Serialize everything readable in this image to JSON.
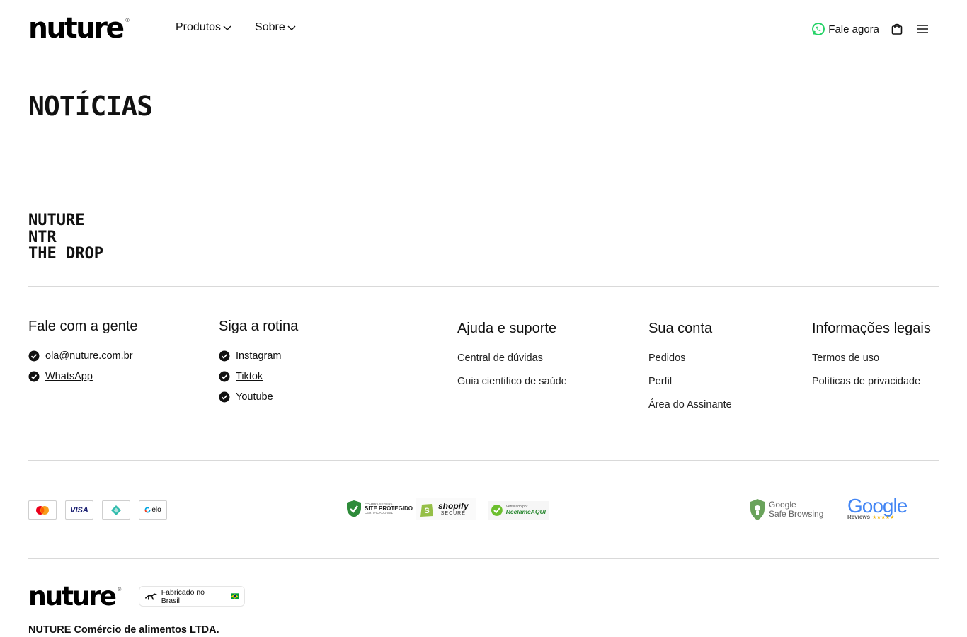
{
  "header": {
    "logo": "nuture",
    "logo_mark": "®",
    "nav": [
      {
        "label": "Produtos"
      },
      {
        "label": "Sobre"
      }
    ],
    "contact_label": "Fale agora",
    "icons": {
      "whatsapp": "whatsapp-icon",
      "cart": "shopping-bag-icon",
      "menu": "hamburger-menu-icon",
      "chevron": "chevron-down-icon"
    },
    "accent_color": "#25d366"
  },
  "page": {
    "title": "NOTÍCIAS"
  },
  "brands": [
    "NUTURE",
    "NTR",
    "THE DROP"
  ],
  "footer": {
    "contact": {
      "title": "Fale com a gente",
      "links": [
        "ola@nuture.com.br",
        "WhatsApp"
      ]
    },
    "social": {
      "title": "Siga a rotina",
      "links": [
        "Instagram",
        "Tiktok",
        "Youtube"
      ]
    },
    "help": {
      "title": "Ajuda e suporte",
      "links": [
        "Central de dúvidas",
        "Guia cientifico de saúde"
      ]
    },
    "account": {
      "title": "Sua conta",
      "links": [
        "Pedidos",
        "Perfil",
        "Área do Assinante"
      ]
    },
    "legal": {
      "title": "Informações legais",
      "links": [
        "Termos de uso",
        "Políticas de privacidade"
      ]
    },
    "payments": {
      "visa": "VISA",
      "elo": "elo",
      "icons": [
        "mastercard-icon",
        "visa-icon",
        "pix-icon",
        "elo-icon"
      ]
    },
    "seals": {
      "site_protegido_top": "COMPRA SEGURA",
      "site_protegido": "SITE PROTEGIDO",
      "site_protegido_sub": "CERTIFICADO SSL",
      "shopify": "shopify",
      "shopify_sub": "SECURE",
      "reclame_top": "Verificado por",
      "reclame": "ReclameAQUI",
      "google_safe_1": "Google",
      "google_safe_2": "Safe Browsing",
      "google_reviews": "Google",
      "google_reviews_sub": "Reviews",
      "stars": "★★★★★"
    },
    "made_in": "Fabricado no Brasil",
    "company": "NUTURE Comércio de alimentos LTDA."
  }
}
